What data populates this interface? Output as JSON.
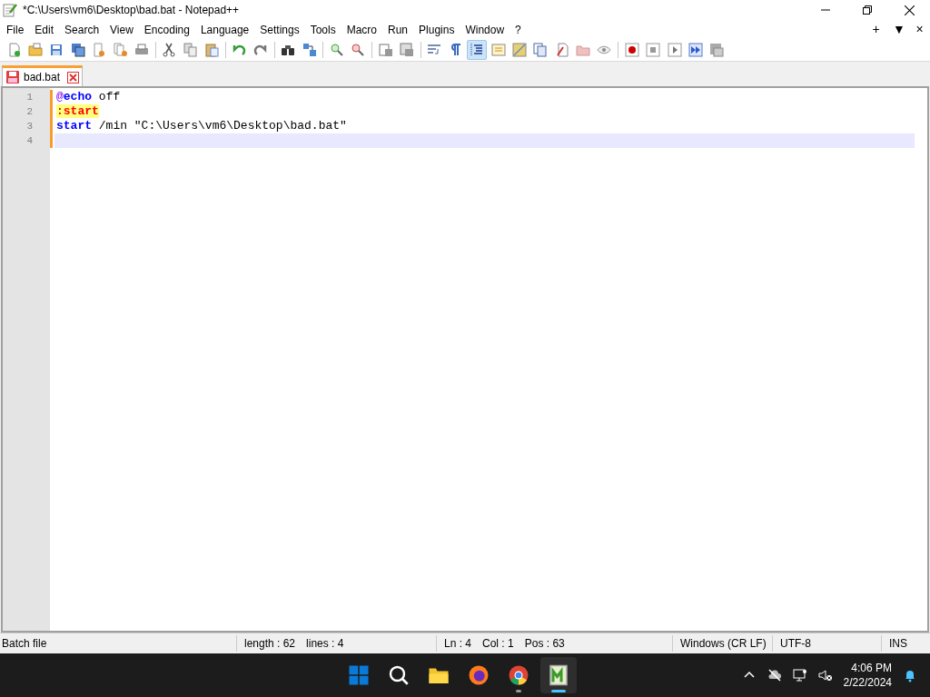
{
  "window": {
    "title": "*C:\\Users\\vm6\\Desktop\\bad.bat - Notepad++"
  },
  "menu": [
    "File",
    "Edit",
    "Search",
    "View",
    "Encoding",
    "Language",
    "Settings",
    "Tools",
    "Macro",
    "Run",
    "Plugins",
    "Window",
    "?"
  ],
  "menu_right": [
    "+",
    "▼",
    "×"
  ],
  "toolbar": [
    [
      {
        "selected": false
      },
      {
        "selected": false
      },
      {
        "selected": false
      },
      {
        "selected": false
      },
      {
        "selected": false
      },
      {
        "selected": false
      },
      {
        "selected": false
      }
    ],
    [
      {
        "selected": false
      },
      {
        "selected": false
      },
      {
        "selected": false
      }
    ],
    [
      {
        "selected": false
      },
      {
        "selected": false
      }
    ],
    [
      {
        "selected": false
      },
      {
        "selected": false
      }
    ],
    [
      {
        "selected": false
      },
      {
        "selected": false
      }
    ],
    [
      {
        "selected": false
      },
      {
        "selected": false
      }
    ],
    [
      {
        "selected": false
      },
      {
        "selected": false
      },
      {
        "selected": true
      },
      {
        "selected": false
      },
      {
        "selected": false
      },
      {
        "selected": false
      },
      {
        "selected": false
      },
      {
        "selected": false
      },
      {
        "selected": false
      }
    ],
    [
      {
        "selected": false
      },
      {
        "selected": false
      },
      {
        "selected": false
      },
      {
        "selected": false
      },
      {
        "selected": false
      }
    ]
  ],
  "tabs": [
    {
      "label": "bad.bat",
      "selected": true,
      "modified": true
    }
  ],
  "editor": {
    "lines": [
      {
        "number": "1",
        "current": false,
        "tokens": [
          {
            "kind": "at",
            "text": "@"
          },
          {
            "kind": "keyword",
            "text": "echo"
          },
          {
            "kind": "plain",
            "text": " off"
          }
        ]
      },
      {
        "number": "2",
        "current": false,
        "tokens": [
          {
            "kind": "label",
            "text": ":start"
          }
        ]
      },
      {
        "number": "3",
        "current": false,
        "tokens": [
          {
            "kind": "keyword",
            "text": "start"
          },
          {
            "kind": "plain",
            "text": " /min \"C:\\Users\\vm6\\Desktop\\bad.bat\""
          }
        ]
      },
      {
        "number": "4",
        "current": true
      }
    ]
  },
  "status_bar": {
    "language": "Batch file",
    "length": "length : 62",
    "lines": "lines : 4",
    "ln": "Ln : 4",
    "col": "Col : 1",
    "pos": "Pos : 63",
    "eol": "Windows (CR LF)",
    "encoding": "UTF-8",
    "mode": "INS"
  },
  "taskbar": {
    "apps": [
      {
        "running": false,
        "active": false
      },
      {
        "running": false,
        "active": false
      },
      {
        "running": false,
        "active": false
      },
      {
        "running": false,
        "active": false
      },
      {
        "running": true,
        "active": false
      },
      {
        "running": true,
        "active": true
      }
    ],
    "time": "4:06 PM",
    "date": "2/22/2024"
  }
}
